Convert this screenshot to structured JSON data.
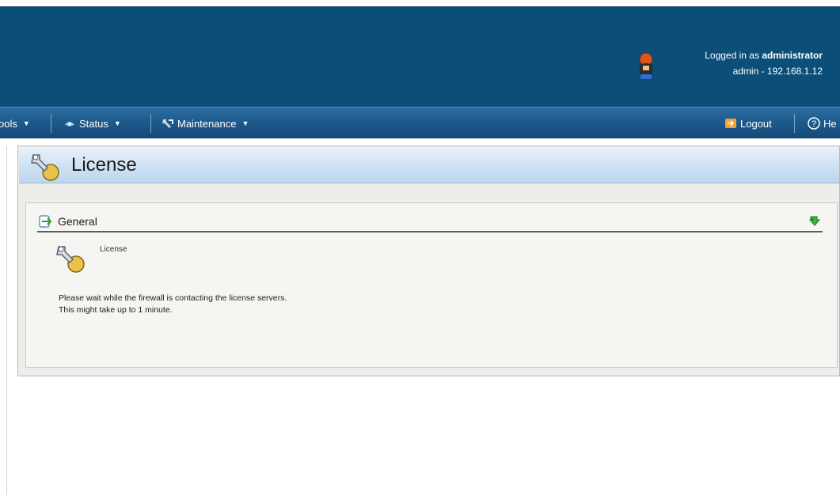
{
  "header": {
    "logged_in_prefix": "Logged in as",
    "logged_in_role": "administrator",
    "session": "admin - 192.168.1.12"
  },
  "menubar": {
    "items": [
      {
        "label": "ools",
        "icon": "none"
      },
      {
        "label": "Status",
        "icon": "status-icon"
      },
      {
        "label": "Maintenance",
        "icon": "wrench-icon"
      }
    ],
    "logout_label": "Logout",
    "help_label": "He"
  },
  "panel": {
    "title": "License",
    "section_title": "General",
    "item_label": "License",
    "message_line1": "Please wait while the firewall is contacting the license servers.",
    "message_line2": "This might take up to 1 minute."
  },
  "colors": {
    "header_bg": "#0b4f79",
    "menubar_bg": "#1e5b8d",
    "panel_title_bg": "#cfe2f4",
    "panel_bg": "#ededea"
  }
}
